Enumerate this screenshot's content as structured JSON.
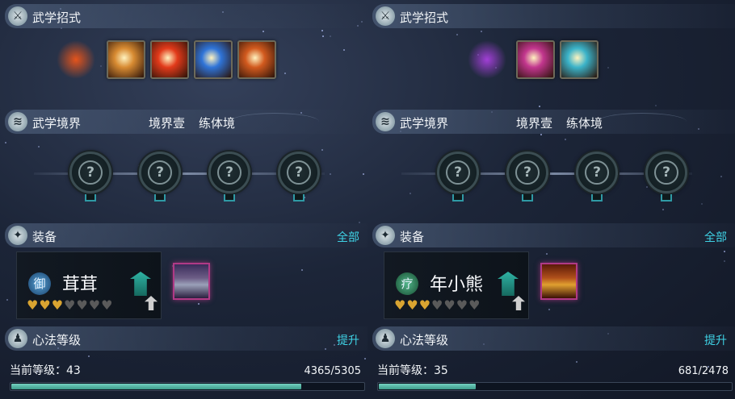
{
  "panels": [
    {
      "skills_title": "武学招式",
      "skills": [
        {
          "icon": "fire-body-skill-icon",
          "color": "#e5541c"
        },
        {
          "icon": "buddha-face-skill-icon",
          "color": "#d88b32"
        },
        {
          "icon": "explosion-skill-icon",
          "color": "#e23a1a"
        },
        {
          "icon": "crescent-moon-skill-icon",
          "color": "#2f74d8"
        },
        {
          "icon": "flame-whirl-skill-icon",
          "color": "#d25a1e"
        }
      ],
      "realm_title": "武学境界",
      "realm_level": "境界壹",
      "realm_name": "练体境",
      "realm_node_glyph": "?",
      "equip_title": "装备",
      "equip_link": "全部",
      "equip_type_glyph": "御",
      "player_name": "茸茸",
      "hearts": {
        "filled": 2.5,
        "total": 7
      },
      "gear_icon": "silver-armor-icon",
      "heart_title": "心法等级",
      "heart_link": "提升",
      "level_label": "当前等级：43",
      "level_progress": "4365/5305",
      "progress": {
        "current": 4365,
        "max": 5305
      }
    },
    {
      "skills_title": "武学招式",
      "skills": [
        {
          "icon": "purple-spike-skill-icon",
          "color": "#a13fd6"
        },
        {
          "icon": "pink-dancer-skill-icon",
          "color": "#c2368e"
        },
        {
          "icon": "cyan-shark-skill-icon",
          "color": "#3bb3c9"
        }
      ],
      "realm_title": "武学境界",
      "realm_level": "境界壹",
      "realm_name": "练体境",
      "realm_node_glyph": "?",
      "equip_title": "装备",
      "equip_link": "全部",
      "equip_type_glyph": "疗",
      "player_name": "年小熊",
      "hearts": {
        "filled": 2.5,
        "total": 7
      },
      "gear_icon": "golden-armor-icon",
      "heart_title": "心法等级",
      "heart_link": "提升",
      "level_label": "当前等级：35",
      "level_progress": "681/2478",
      "progress": {
        "current": 681,
        "max": 2478
      }
    }
  ]
}
